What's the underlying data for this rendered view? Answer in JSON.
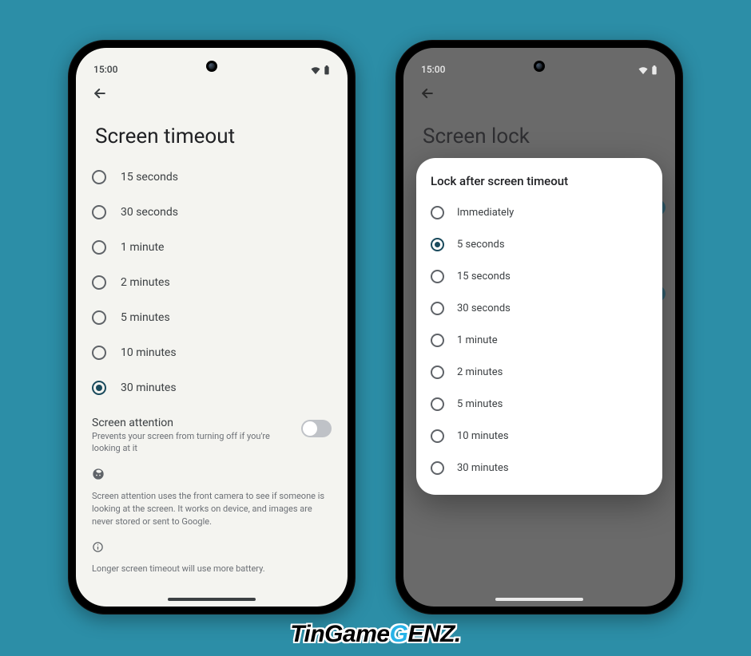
{
  "background_color": "#2c8ea7",
  "status_time": "15:00",
  "left": {
    "title": "Screen timeout",
    "options": [
      {
        "label": "15 seconds",
        "checked": false
      },
      {
        "label": "30 seconds",
        "checked": false
      },
      {
        "label": "1 minute",
        "checked": false
      },
      {
        "label": "2 minutes",
        "checked": false
      },
      {
        "label": "5 minutes",
        "checked": false
      },
      {
        "label": "10 minutes",
        "checked": false
      },
      {
        "label": "30 minutes",
        "checked": true
      }
    ],
    "attention": {
      "title": "Screen attention",
      "subtitle": "Prevents your screen from turning off if you're looking at it",
      "on": false
    },
    "attention_info": "Screen attention uses the front camera to see if someone is looking at the screen. It works on device, and images are never stored or sent to Google.",
    "battery_info": "Longer screen timeout will use more battery."
  },
  "right": {
    "title": "Screen lock",
    "dialog_title": "Lock after screen timeout",
    "options": [
      {
        "label": "Immediately",
        "checked": false
      },
      {
        "label": "5 seconds",
        "checked": true
      },
      {
        "label": "15 seconds",
        "checked": false
      },
      {
        "label": "30 seconds",
        "checked": false
      },
      {
        "label": "1 minute",
        "checked": false
      },
      {
        "label": "2 minutes",
        "checked": false
      },
      {
        "label": "5 minutes",
        "checked": false
      },
      {
        "label": "10 minutes",
        "checked": false
      },
      {
        "label": "30 minutes",
        "checked": false
      }
    ]
  },
  "watermark": {
    "part1": "TinGame",
    "accent": "G",
    "part2": "ENZ",
    "dot": "."
  }
}
